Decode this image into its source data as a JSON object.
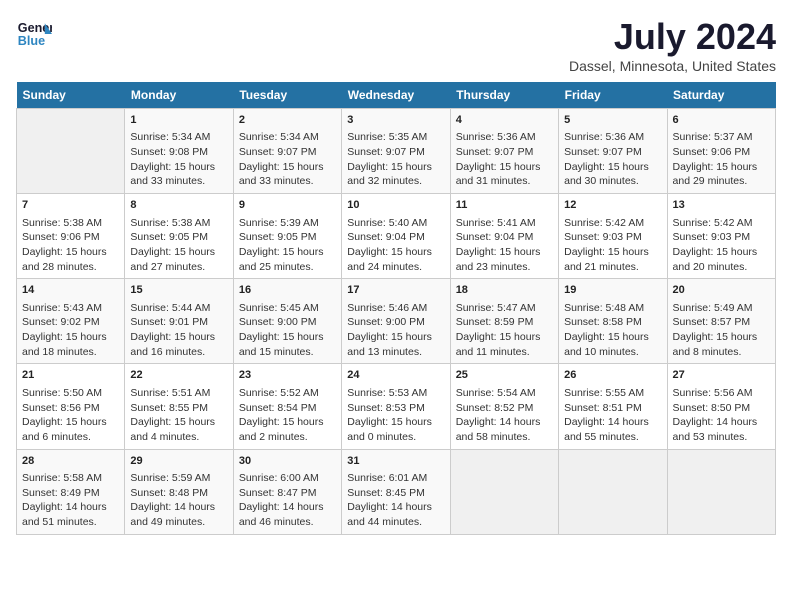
{
  "header": {
    "logo_line1": "General",
    "logo_line2": "Blue",
    "title": "July 2024",
    "subtitle": "Dassel, Minnesota, United States"
  },
  "days_of_week": [
    "Sunday",
    "Monday",
    "Tuesday",
    "Wednesday",
    "Thursday",
    "Friday",
    "Saturday"
  ],
  "weeks": [
    [
      {
        "day": "",
        "info": ""
      },
      {
        "day": "1",
        "info": "Sunrise: 5:34 AM\nSunset: 9:08 PM\nDaylight: 15 hours\nand 33 minutes."
      },
      {
        "day": "2",
        "info": "Sunrise: 5:34 AM\nSunset: 9:07 PM\nDaylight: 15 hours\nand 33 minutes."
      },
      {
        "day": "3",
        "info": "Sunrise: 5:35 AM\nSunset: 9:07 PM\nDaylight: 15 hours\nand 32 minutes."
      },
      {
        "day": "4",
        "info": "Sunrise: 5:36 AM\nSunset: 9:07 PM\nDaylight: 15 hours\nand 31 minutes."
      },
      {
        "day": "5",
        "info": "Sunrise: 5:36 AM\nSunset: 9:07 PM\nDaylight: 15 hours\nand 30 minutes."
      },
      {
        "day": "6",
        "info": "Sunrise: 5:37 AM\nSunset: 9:06 PM\nDaylight: 15 hours\nand 29 minutes."
      }
    ],
    [
      {
        "day": "7",
        "info": "Sunrise: 5:38 AM\nSunset: 9:06 PM\nDaylight: 15 hours\nand 28 minutes."
      },
      {
        "day": "8",
        "info": "Sunrise: 5:38 AM\nSunset: 9:05 PM\nDaylight: 15 hours\nand 27 minutes."
      },
      {
        "day": "9",
        "info": "Sunrise: 5:39 AM\nSunset: 9:05 PM\nDaylight: 15 hours\nand 25 minutes."
      },
      {
        "day": "10",
        "info": "Sunrise: 5:40 AM\nSunset: 9:04 PM\nDaylight: 15 hours\nand 24 minutes."
      },
      {
        "day": "11",
        "info": "Sunrise: 5:41 AM\nSunset: 9:04 PM\nDaylight: 15 hours\nand 23 minutes."
      },
      {
        "day": "12",
        "info": "Sunrise: 5:42 AM\nSunset: 9:03 PM\nDaylight: 15 hours\nand 21 minutes."
      },
      {
        "day": "13",
        "info": "Sunrise: 5:42 AM\nSunset: 9:03 PM\nDaylight: 15 hours\nand 20 minutes."
      }
    ],
    [
      {
        "day": "14",
        "info": "Sunrise: 5:43 AM\nSunset: 9:02 PM\nDaylight: 15 hours\nand 18 minutes."
      },
      {
        "day": "15",
        "info": "Sunrise: 5:44 AM\nSunset: 9:01 PM\nDaylight: 15 hours\nand 16 minutes."
      },
      {
        "day": "16",
        "info": "Sunrise: 5:45 AM\nSunset: 9:00 PM\nDaylight: 15 hours\nand 15 minutes."
      },
      {
        "day": "17",
        "info": "Sunrise: 5:46 AM\nSunset: 9:00 PM\nDaylight: 15 hours\nand 13 minutes."
      },
      {
        "day": "18",
        "info": "Sunrise: 5:47 AM\nSunset: 8:59 PM\nDaylight: 15 hours\nand 11 minutes."
      },
      {
        "day": "19",
        "info": "Sunrise: 5:48 AM\nSunset: 8:58 PM\nDaylight: 15 hours\nand 10 minutes."
      },
      {
        "day": "20",
        "info": "Sunrise: 5:49 AM\nSunset: 8:57 PM\nDaylight: 15 hours\nand 8 minutes."
      }
    ],
    [
      {
        "day": "21",
        "info": "Sunrise: 5:50 AM\nSunset: 8:56 PM\nDaylight: 15 hours\nand 6 minutes."
      },
      {
        "day": "22",
        "info": "Sunrise: 5:51 AM\nSunset: 8:55 PM\nDaylight: 15 hours\nand 4 minutes."
      },
      {
        "day": "23",
        "info": "Sunrise: 5:52 AM\nSunset: 8:54 PM\nDaylight: 15 hours\nand 2 minutes."
      },
      {
        "day": "24",
        "info": "Sunrise: 5:53 AM\nSunset: 8:53 PM\nDaylight: 15 hours\nand 0 minutes."
      },
      {
        "day": "25",
        "info": "Sunrise: 5:54 AM\nSunset: 8:52 PM\nDaylight: 14 hours\nand 58 minutes."
      },
      {
        "day": "26",
        "info": "Sunrise: 5:55 AM\nSunset: 8:51 PM\nDaylight: 14 hours\nand 55 minutes."
      },
      {
        "day": "27",
        "info": "Sunrise: 5:56 AM\nSunset: 8:50 PM\nDaylight: 14 hours\nand 53 minutes."
      }
    ],
    [
      {
        "day": "28",
        "info": "Sunrise: 5:58 AM\nSunset: 8:49 PM\nDaylight: 14 hours\nand 51 minutes."
      },
      {
        "day": "29",
        "info": "Sunrise: 5:59 AM\nSunset: 8:48 PM\nDaylight: 14 hours\nand 49 minutes."
      },
      {
        "day": "30",
        "info": "Sunrise: 6:00 AM\nSunset: 8:47 PM\nDaylight: 14 hours\nand 46 minutes."
      },
      {
        "day": "31",
        "info": "Sunrise: 6:01 AM\nSunset: 8:45 PM\nDaylight: 14 hours\nand 44 minutes."
      },
      {
        "day": "",
        "info": ""
      },
      {
        "day": "",
        "info": ""
      },
      {
        "day": "",
        "info": ""
      }
    ]
  ]
}
